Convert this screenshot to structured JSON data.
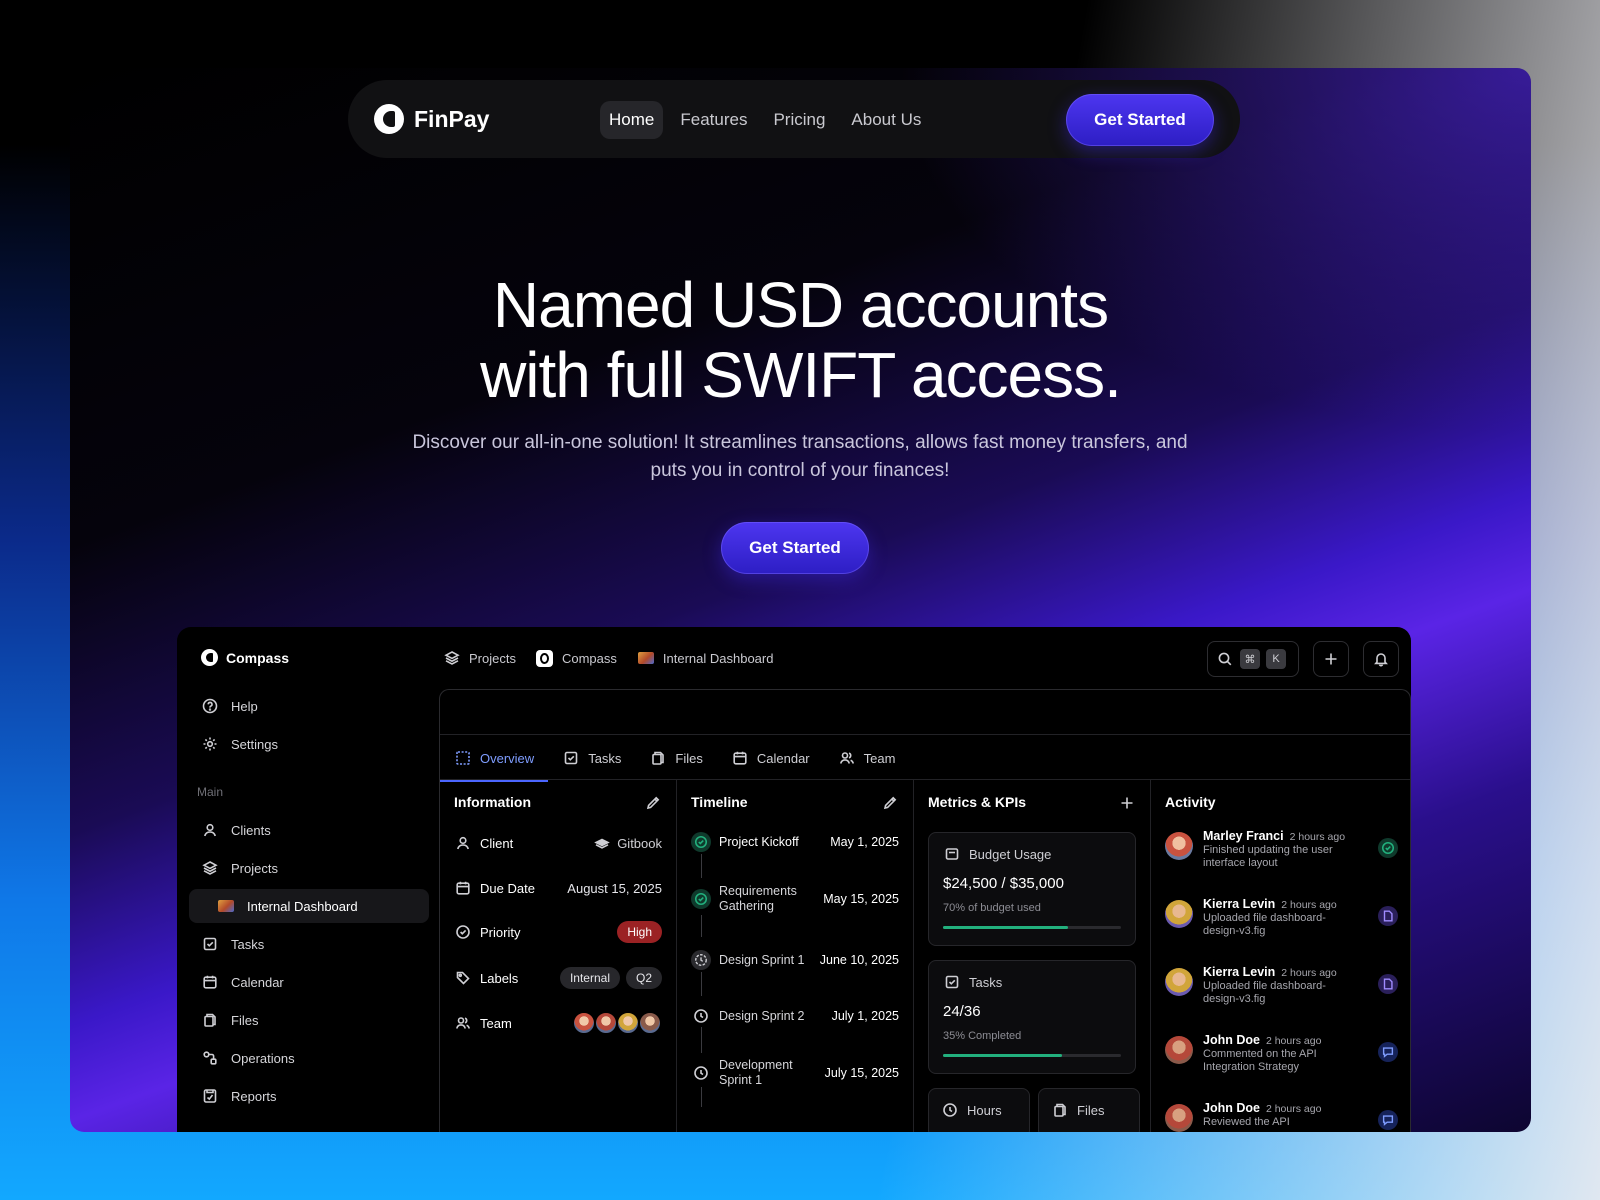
{
  "nav": {
    "brand": "FinPay",
    "links": [
      {
        "label": "Home",
        "active": true
      },
      {
        "label": "Features"
      },
      {
        "label": "Pricing"
      },
      {
        "label": "About Us"
      }
    ],
    "cta": "Get Started"
  },
  "hero": {
    "title_line1": "Named USD accounts",
    "title_line2": "with full SWIFT access.",
    "subtitle": "Discover our all-in-one solution! It streamlines transactions, allows fast money transfers, and puts you in control of your finances!",
    "cta": "Get Started"
  },
  "app": {
    "brand": "Compass",
    "side": {
      "top": [
        {
          "label": "Help",
          "icon": "help-icon"
        },
        {
          "label": "Settings",
          "icon": "gear-icon"
        }
      ],
      "group_label": "Main",
      "items": [
        {
          "label": "Clients",
          "icon": "user-icon"
        },
        {
          "label": "Projects",
          "icon": "layers-icon"
        },
        {
          "label": "Internal Dashboard",
          "icon": "project-thumb-icon",
          "selected": true
        },
        {
          "label": "Tasks",
          "icon": "checkbox-icon"
        },
        {
          "label": "Calendar",
          "icon": "calendar-icon"
        },
        {
          "label": "Files",
          "icon": "files-icon"
        },
        {
          "label": "Operations",
          "icon": "operations-icon"
        },
        {
          "label": "Reports",
          "icon": "reports-icon"
        }
      ]
    },
    "breadcrumbs": [
      {
        "label": "Projects",
        "icon": "layers-icon"
      },
      {
        "label": "Compass",
        "icon": "compass-logo-icon"
      },
      {
        "label": "Internal Dashboard",
        "icon": "project-thumb-icon"
      }
    ],
    "shortcut_keys": [
      "⌘",
      "K"
    ],
    "tabs": [
      {
        "label": "Overview",
        "icon": "overview-icon",
        "active": true
      },
      {
        "label": "Tasks",
        "icon": "checkbox-icon"
      },
      {
        "label": "Files",
        "icon": "files-icon"
      },
      {
        "label": "Calendar",
        "icon": "calendar-icon"
      },
      {
        "label": "Team",
        "icon": "team-icon"
      }
    ],
    "information": {
      "title": "Information",
      "client_label": "Client",
      "client_value": "Gitbook",
      "due_label": "Due Date",
      "due_value": "August 15, 2025",
      "priority_label": "Priority",
      "priority_value": "High",
      "labels_label": "Labels",
      "labels": [
        "Internal",
        "Q2"
      ],
      "team_label": "Team",
      "team_colors": [
        "#c9523f",
        "#b5483a",
        "#d1a53a",
        "#8a5a4a"
      ]
    },
    "timeline": {
      "title": "Timeline",
      "items": [
        {
          "label": "Project Kickoff",
          "date": "May 1, 2025",
          "status": "done"
        },
        {
          "label": "Requirements Gathering",
          "date": "May 15, 2025",
          "status": "done"
        },
        {
          "label": "Design Sprint 1",
          "date": "June 10, 2025",
          "status": "in-progress"
        },
        {
          "label": "Design Sprint 2",
          "date": "July 1, 2025",
          "status": "pending"
        },
        {
          "label": "Development Sprint 1",
          "date": "July 15, 2025",
          "status": "pending"
        }
      ]
    },
    "metrics": {
      "title": "Metrics & KPIs",
      "budget_label": "Budget Usage",
      "budget_value": "$24,500 / $35,000",
      "budget_note": "70% of budget used",
      "budget_fraction": 0.7,
      "tasks_label": "Tasks",
      "tasks_value": "24/36",
      "tasks_note": "35% Completed",
      "tasks_fraction": 0.67,
      "hours_label": "Hours",
      "files_label": "Files"
    },
    "activity": {
      "title": "Activity",
      "items": [
        {
          "name": "Marley Franci",
          "time": "2 hours ago",
          "text": "Finished updating the user interface layout",
          "icon": "check-icon",
          "accent": "#22b07d"
        },
        {
          "name": "Kierra Levin",
          "time": "2 hours ago",
          "text": "Uploaded file dashboard-design-v3.fig",
          "icon": "file-icon",
          "accent": "#7b5cff"
        },
        {
          "name": "Kierra Levin",
          "time": "2 hours ago",
          "text": "Uploaded file dashboard-design-v3.fig",
          "icon": "file-icon",
          "accent": "#7b5cff"
        },
        {
          "name": "John Doe",
          "time": "2 hours ago",
          "text": "Commented on the API Integration Strategy",
          "icon": "comment-icon",
          "accent": "#4b66ff"
        },
        {
          "name": "John Doe",
          "time": "2 hours ago",
          "text": "Reviewed the API",
          "icon": "comment-icon",
          "accent": "#4b66ff"
        }
      ]
    }
  }
}
